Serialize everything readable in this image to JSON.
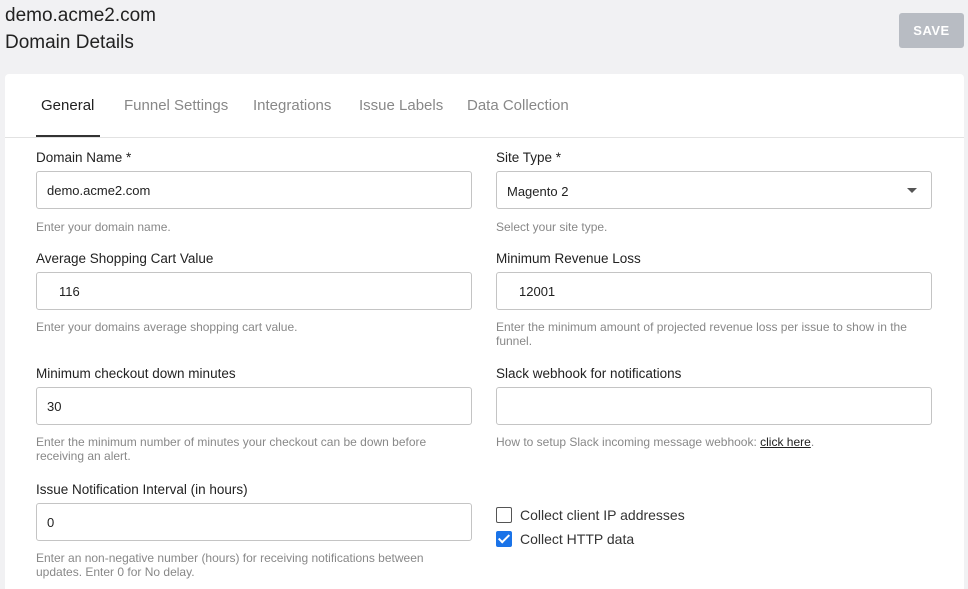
{
  "header": {
    "domain": "demo.acme2.com",
    "title": "Domain Details",
    "save_label": "SAVE"
  },
  "tabs": [
    {
      "label": "General",
      "active": true
    },
    {
      "label": "Funnel Settings",
      "active": false
    },
    {
      "label": "Integrations",
      "active": false
    },
    {
      "label": "Issue Labels",
      "active": false
    },
    {
      "label": "Data Collection",
      "active": false
    }
  ],
  "form": {
    "domain_name": {
      "label": "Domain Name *",
      "value": "demo.acme2.com",
      "help": "Enter your domain name."
    },
    "site_type": {
      "label": "Site Type *",
      "value": "Magento 2",
      "help": "Select your site type."
    },
    "avg_cart": {
      "label": "Average Shopping Cart Value",
      "value": "116",
      "help": "Enter your domains average shopping cart value."
    },
    "min_revenue": {
      "label": "Minimum Revenue Loss",
      "value": "12001",
      "help": "Enter the minimum amount of projected revenue loss per issue to show in the funnel."
    },
    "min_checkout": {
      "label": "Minimum checkout down minutes",
      "value": "30",
      "help": "Enter the minimum number of minutes your checkout can be down before receiving an alert."
    },
    "slack": {
      "label": "Slack webhook for notifications",
      "value": "",
      "help_prefix": "How to setup Slack incoming message webhook: ",
      "help_link": "click here",
      "help_suffix": "."
    },
    "interval": {
      "label": "Issue Notification Interval (in hours)",
      "value": "0",
      "help": "Enter an non-negative number (hours) for receiving notifications between updates. Enter 0 for No delay."
    },
    "collect_ip": {
      "label": "Collect client IP addresses",
      "checked": false
    },
    "collect_http": {
      "label": "Collect HTTP data",
      "checked": true
    }
  },
  "colors": {
    "accent": "#1a73e8",
    "save_disabled": "#b8bcc3"
  }
}
